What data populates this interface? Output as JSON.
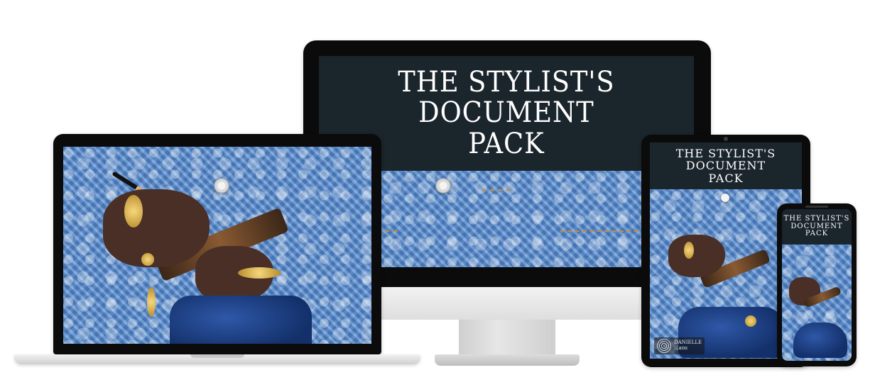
{
  "product": {
    "title_lines": [
      "THE STYLIST'S",
      "DOCUMENT",
      "PACK"
    ]
  },
  "brand_logo": {
    "text_lines": [
      "DANIELLE",
      "...ans"
    ]
  },
  "colors": {
    "screen_dark": "#1b252c",
    "denim": "#5b8fcf",
    "device_frame": "#0b0b0b",
    "stand_silver": "#d9d9d9"
  },
  "icons": {
    "monitor": "desktop-monitor-icon",
    "laptop": "laptop-icon",
    "tablet": "tablet-icon",
    "phone": "smartphone-icon"
  }
}
